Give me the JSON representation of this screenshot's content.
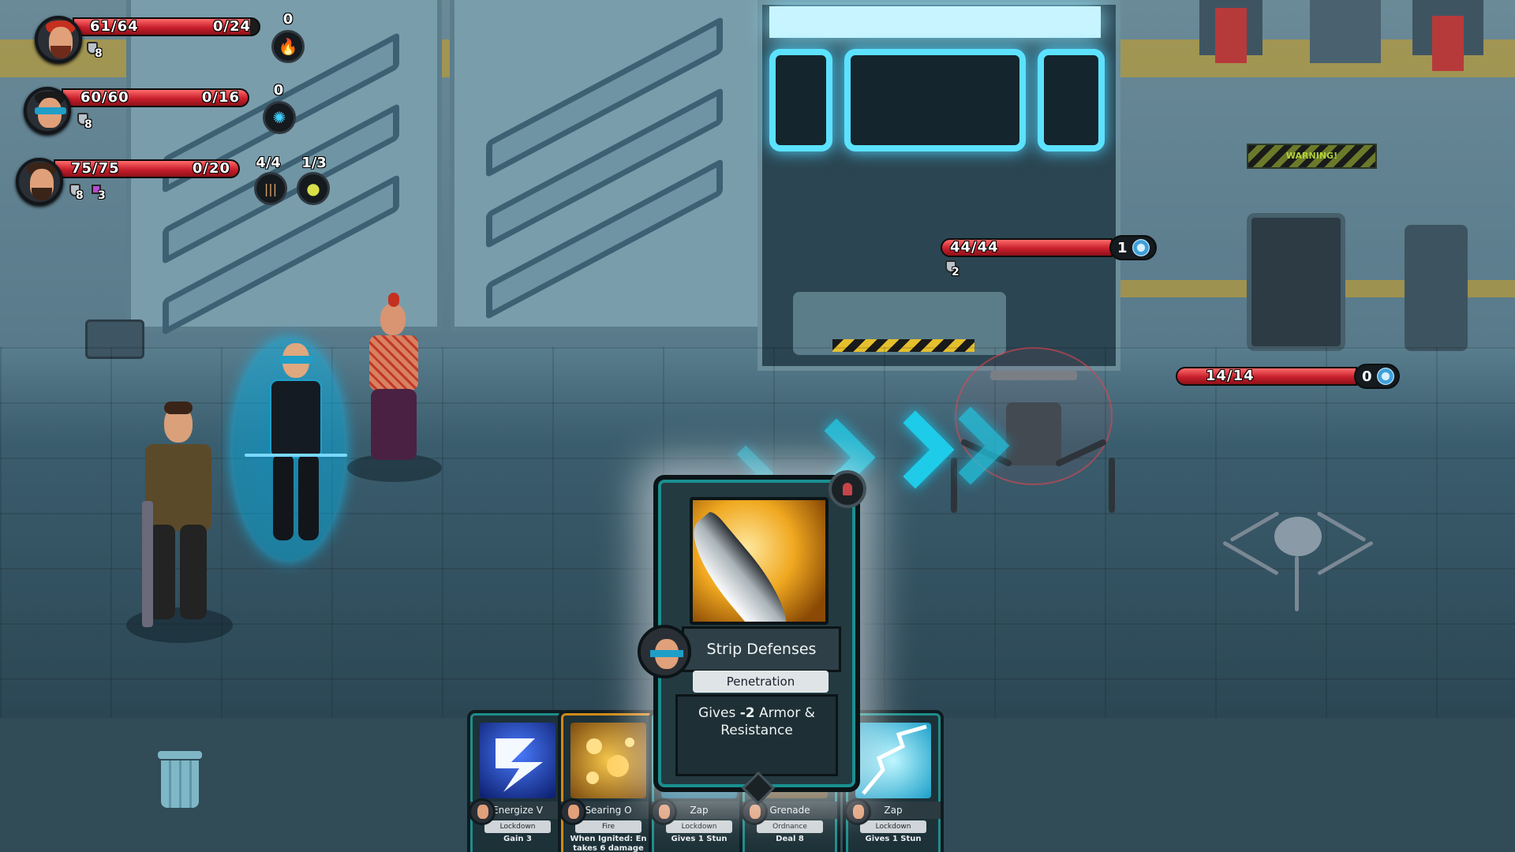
{
  "party": [
    {
      "name_icon": "red-mohawk-portrait",
      "hp": "61/64",
      "hp_fraction": 0.953,
      "resource": "0/24",
      "armor": "8",
      "resource_count": "0",
      "resource_icon": "fire-icon"
    },
    {
      "name_icon": "visor-portrait",
      "hp": "60/60",
      "hp_fraction": 1.0,
      "resource": "0/16",
      "armor": "8",
      "resource_count": "0",
      "resource_icon": "energy-orb-icon"
    },
    {
      "name_icon": "bearded-soldier-portrait",
      "hp": "75/75",
      "hp_fraction": 1.0,
      "resource": "0/20",
      "armor": "8",
      "debuff": "3",
      "resource_count": "4/4",
      "resource_icon": "ammo-icon",
      "resource_count_2": "1/3",
      "resource_icon_2": "grenade-icon"
    }
  ],
  "enemies": [
    {
      "name_icon": "turret-drone",
      "hp": "44/44",
      "hp_fraction": 1.0,
      "intent": "1",
      "armor": "2"
    },
    {
      "name_icon": "spider-drone",
      "hp": "14/14",
      "hp_fraction": 1.0,
      "intent": "0"
    }
  ],
  "warning_sign": "WARNING!",
  "selected_card": {
    "title": "Strip Defenses",
    "type": "Penetration",
    "desc_prefix": "Gives ",
    "desc_value": "-2",
    "desc_suffix": " Armor & Resistance"
  },
  "hand": [
    {
      "name": "Energize V",
      "type": "Lockdown",
      "desc": "Gain 3"
    },
    {
      "name": "Searing O",
      "type": "Fire",
      "desc": "When Ignited: En takes 6 damage"
    },
    {
      "name": "Zap",
      "type": "Lockdown",
      "desc": "Gives 1 Stun"
    },
    {
      "name": "Grenade",
      "type": "Ordnance",
      "desc": "Deal 8"
    },
    {
      "name": "Zap",
      "type": "Lockdown",
      "desc": "Gives 1 Stun"
    }
  ],
  "colors": {
    "hp_red": "#c81f2c",
    "card_teal": "#1a8f90",
    "arrow_cyan": "#1ecbe8",
    "shield_blue": "#16b6ea"
  }
}
